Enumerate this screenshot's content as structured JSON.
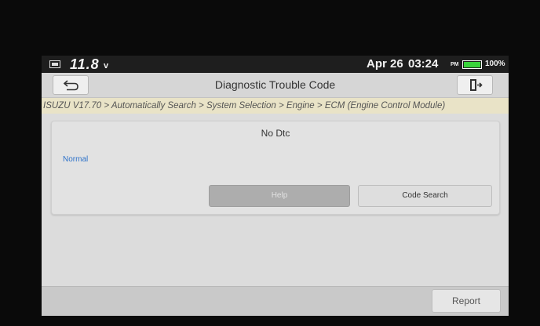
{
  "status_bar": {
    "voltage": "11.8",
    "voltage_unit": "v",
    "date": "Apr 26",
    "time": "03:24",
    "ampm": "PM",
    "battery_percent": "100%",
    "battery_level": 1.0,
    "battery_color": "#39d33b"
  },
  "header": {
    "title": "Diagnostic Trouble Code",
    "back_icon": "back-arrow-icon",
    "exit_icon": "exit-door-icon"
  },
  "breadcrumb": "ISUZU V17.70 > Automatically Search > System Selection > Engine > ECM (Engine Control Module)",
  "card": {
    "title": "No Dtc",
    "status": "Normal",
    "status_color": "#2e72c9",
    "help_label": "Help",
    "code_search_label": "Code Search"
  },
  "footer": {
    "report_label": "Report"
  }
}
